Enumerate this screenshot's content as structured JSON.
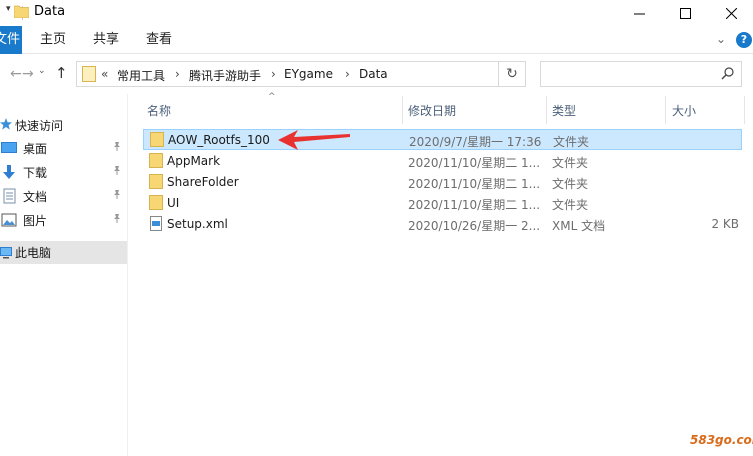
{
  "window": {
    "title": "Data",
    "controls": {
      "minimize": "—",
      "maximize": "☐",
      "close": "✕"
    }
  },
  "ribbon": {
    "file_tab": "文件",
    "tabs": [
      "主页",
      "共享",
      "查看"
    ],
    "collapse": "⌄",
    "help": "?"
  },
  "address": {
    "overflow": "«",
    "breadcrumbs": [
      "常用工具",
      "腾讯手游助手",
      "EYgame",
      "Data"
    ],
    "separator": "›",
    "dropdown": "⌄",
    "refresh": "↻",
    "search_placeholder": ""
  },
  "nav_buttons": {
    "back": "←",
    "forward": "→",
    "recent": "⌄",
    "up": "↑"
  },
  "sidebar": {
    "items": [
      {
        "label": "快速访问",
        "icon": "star-icon",
        "pinned": false,
        "selected": false
      },
      {
        "label": "桌面",
        "icon": "desktop-icon",
        "pinned": true
      },
      {
        "label": "下载",
        "icon": "download-icon",
        "pinned": true
      },
      {
        "label": "文档",
        "icon": "document-icon",
        "pinned": true
      },
      {
        "label": "图片",
        "icon": "picture-icon",
        "pinned": true
      },
      {
        "label": "此电脑",
        "icon": "computer-icon",
        "pinned": false,
        "selected": true
      }
    ],
    "pin_glyph": "📌"
  },
  "columns": {
    "name": "名称",
    "date": "修改日期",
    "type": "类型",
    "size": "大小"
  },
  "sort_indicator": "^",
  "files": [
    {
      "name": "AOW_Rootfs_100",
      "date": "2020/9/7/星期一 17:36",
      "type": "文件夹",
      "size": "",
      "icon": "folder-icon",
      "selected": true
    },
    {
      "name": "AppMark",
      "date": "2020/11/10/星期二 1...",
      "type": "文件夹",
      "size": "",
      "icon": "folder-icon"
    },
    {
      "name": "ShareFolder",
      "date": "2020/11/10/星期二 1...",
      "type": "文件夹",
      "size": "",
      "icon": "folder-icon"
    },
    {
      "name": "UI",
      "date": "2020/11/10/星期二 1...",
      "type": "文件夹",
      "size": "",
      "icon": "folder-icon"
    },
    {
      "name": "Setup.xml",
      "date": "2020/10/26/星期一 2...",
      "type": "XML 文档",
      "size": "2 KB",
      "icon": "xml-file-icon"
    }
  ],
  "annotation": {
    "arrow_color": "#e8322f"
  },
  "watermark": "583go.com",
  "colors": {
    "accent": "#1979ca",
    "selection": "#cce8ff",
    "selection_border": "#99d1ff",
    "folder": "#f7d774"
  }
}
